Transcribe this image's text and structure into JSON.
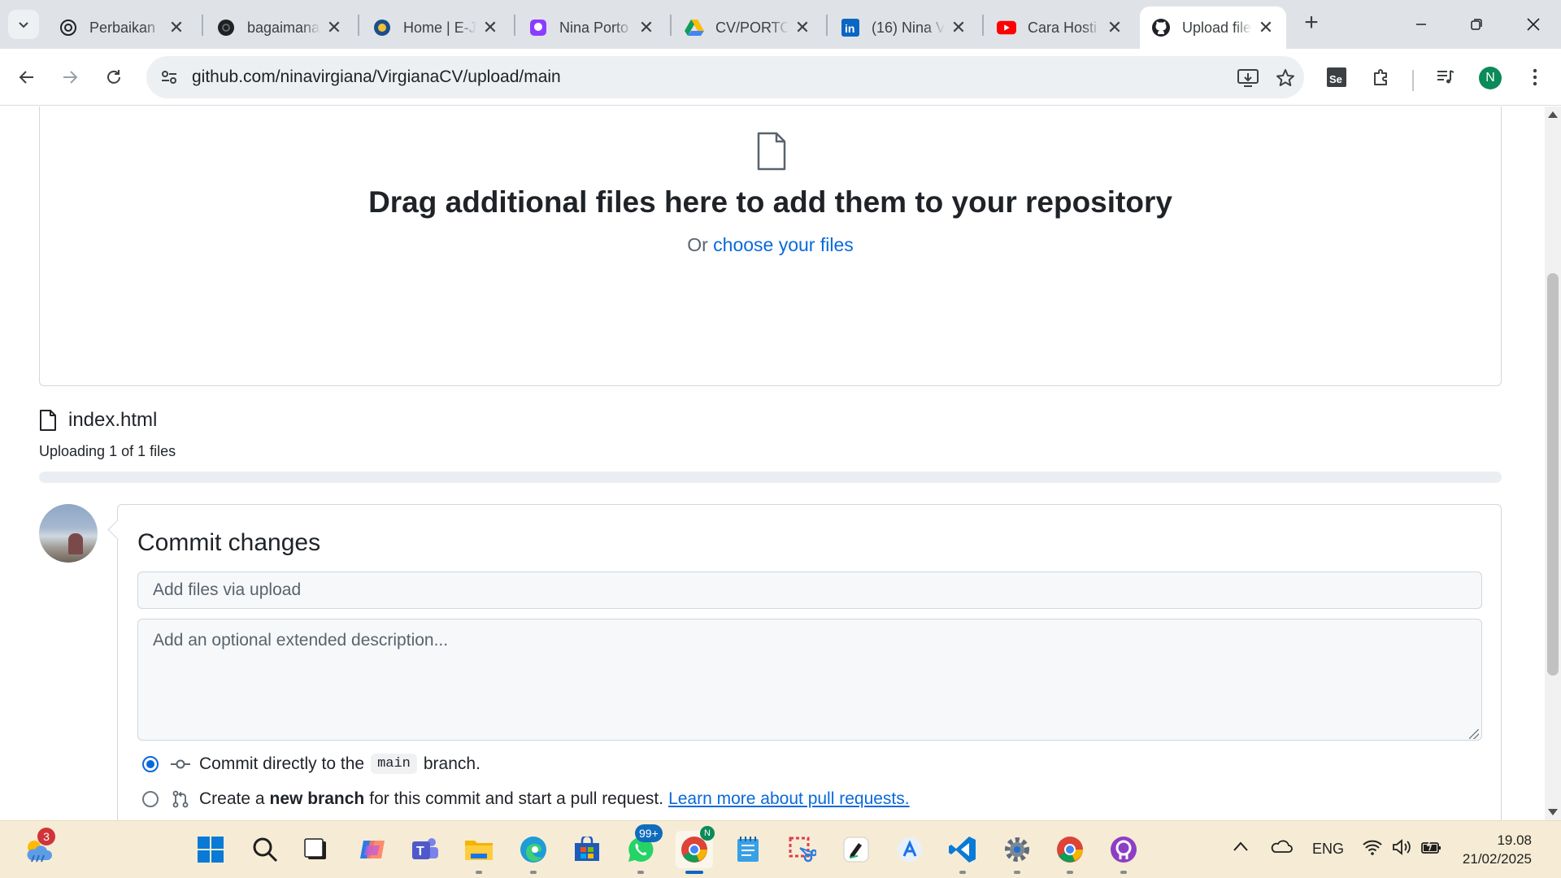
{
  "browser": {
    "tabs": [
      {
        "title": "Perbaikan",
        "favicon": "chatgpt-icon",
        "active": false
      },
      {
        "title": "bagaimana",
        "favicon": "perplexity-icon",
        "active": false
      },
      {
        "title": "Home | E-J",
        "favicon": "university-logo-icon",
        "active": false
      },
      {
        "title": "Nina Porto",
        "favicon": "canva-icon",
        "active": false
      },
      {
        "title": "CV/PORTO",
        "favicon": "google-drive-icon",
        "active": false
      },
      {
        "title": "(16) Nina V",
        "favicon": "linkedin-icon",
        "active": false
      },
      {
        "title": "Cara Hosti",
        "favicon": "youtube-icon",
        "active": false
      },
      {
        "title": "Upload file",
        "favicon": "github-icon",
        "active": true
      }
    ],
    "url": "github.com/ninavirgiana/VirgianaCV/upload/main",
    "profile_initial": "N"
  },
  "dropzone": {
    "title": "Drag additional files here to add them to your repository",
    "or_text": "Or",
    "choose_link": "choose your files"
  },
  "upload": {
    "file_name": "index.html",
    "status": "Uploading 1 of 1 files",
    "progress_fraction": 0
  },
  "commit": {
    "heading": "Commit changes",
    "summary_placeholder": "Add files via upload",
    "description_placeholder": "Add an optional extended description...",
    "option_direct": {
      "prefix": "Commit directly to the",
      "branch": "main",
      "suffix": "branch.",
      "checked": true
    },
    "option_new_branch": {
      "prefix": "Create a",
      "bold": "new branch",
      "suffix": "for this commit and start a pull request.",
      "link": "Learn more about pull requests.",
      "checked": false
    }
  },
  "taskbar": {
    "weather_badge": "3",
    "whatsapp_badge": "99+",
    "language": "ENG",
    "time": "19.08",
    "date": "21/02/2025"
  },
  "colors": {
    "link": "#0969da",
    "tabstrip": "#dfe3e8",
    "taskbar": "#f6ecd5"
  }
}
